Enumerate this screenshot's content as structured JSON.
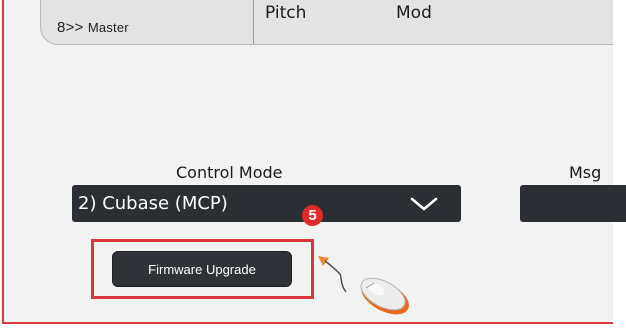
{
  "top_panel": {
    "master_prefix": "8>>",
    "master_text": "Master",
    "pitch_label": "Pitch",
    "mod_label": "Mod"
  },
  "control_mode": {
    "label": "Control Mode",
    "selected_value": "2) Cubase (MCP)"
  },
  "msg": {
    "label": "Msg"
  },
  "badge": {
    "number": "5"
  },
  "firmware": {
    "button_label": "Firmware Upgrade"
  },
  "icons": [
    "chevron-down-icon",
    "pointer-arrow-icon",
    "mouse-icon"
  ],
  "colors": {
    "highlight": "#d9363e",
    "badge": "#e12b2b",
    "control_bg": "#2b2f33",
    "arrow": "#e8872f",
    "mouse_accent": "#e86a1e"
  }
}
